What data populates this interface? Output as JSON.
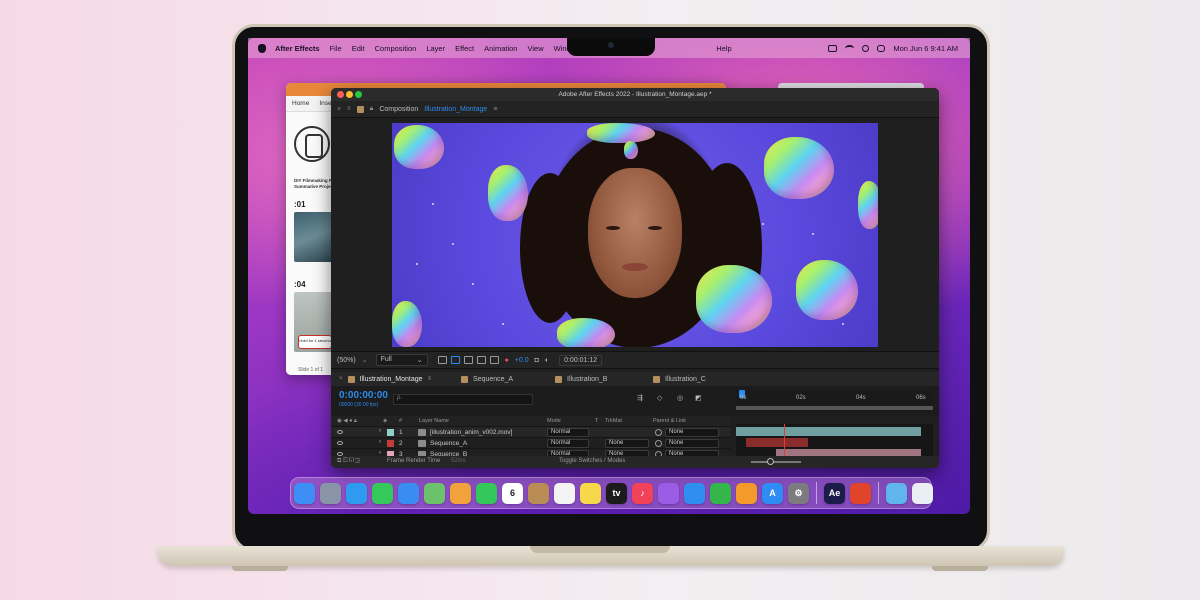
{
  "menubar": {
    "app_name": "After Effects",
    "items": [
      "File",
      "Edit",
      "Composition",
      "Layer",
      "Effect",
      "Animation",
      "View",
      "Window",
      "Help"
    ],
    "clock": "Mon Jun 6  9:41 AM"
  },
  "doc_window": {
    "toolbar": [
      "Home",
      "Inse"
    ],
    "slide_texts": [
      "DIY Filmmaking Pr",
      "Summative Project"
    ],
    "label_01": ":01",
    "label_04": ":04",
    "hold_note": "Hold for 1 second",
    "slide_count": "Slide 1 of 1"
  },
  "ae": {
    "window_title": "Adobe After Effects 2022 - Illustration_Montage.aep *",
    "comp_label": "Composition",
    "comp_name": "Illustration_Montage",
    "zoom": "(50%)",
    "resolution": "Full",
    "exposure": "+0.0",
    "current_time": "0:00:01:12",
    "timeline_tabs": [
      "Illustration_Montage",
      "Sequence_A",
      "Illustration_B",
      "Illustration_C"
    ],
    "timecode": "0:00:00:00",
    "timecode_sub": "00000 (30.00 fps)",
    "search_placeholder": "ρ.",
    "ruler_labels": [
      "0s",
      "02s",
      "04s",
      "06s"
    ],
    "columns": {
      "layer_name": "Layer Name",
      "mode": "Mode",
      "t": "T",
      "trkmat": "TrkMat",
      "parent": "Parent & Link",
      "num": "#"
    },
    "layers": [
      {
        "num": "1",
        "name": "[illustration_anim_v002.mov]",
        "mode": "Normal",
        "trkmat": "",
        "parent": "None",
        "color": "#8fd0c9"
      },
      {
        "num": "2",
        "name": "Sequence_A",
        "mode": "Normal",
        "trkmat": "None",
        "parent": "None",
        "color": "#c63a3a"
      },
      {
        "num": "3",
        "name": "Sequence_B",
        "mode": "Normal",
        "trkmat": "None",
        "parent": "None",
        "color": "#e0a7b5"
      }
    ],
    "footer": {
      "render_label": "Frame Render Time",
      "render_value": "52ms",
      "toggle": "Toggle Switches / Modes"
    }
  },
  "dock_apps": [
    {
      "name": "finder-icon",
      "color": "#3d8ff5",
      "glyph": ""
    },
    {
      "name": "launchpad-icon",
      "color": "#8a94a8",
      "glyph": ""
    },
    {
      "name": "safari-icon",
      "color": "#2f9bf0",
      "glyph": ""
    },
    {
      "name": "messages-icon",
      "color": "#35c85a",
      "glyph": ""
    },
    {
      "name": "mail-icon",
      "color": "#3a8cf2",
      "glyph": ""
    },
    {
      "name": "maps-icon",
      "color": "#6cc26a",
      "glyph": ""
    },
    {
      "name": "photos-icon",
      "color": "#f2a23a",
      "glyph": ""
    },
    {
      "name": "facetime-icon",
      "color": "#34c759",
      "glyph": ""
    },
    {
      "name": "calendar-icon",
      "color": "#ffffff",
      "glyph": "6"
    },
    {
      "name": "notes-brown-icon",
      "color": "#b98c55",
      "glyph": ""
    },
    {
      "name": "reminders-icon",
      "color": "#f4f4f4",
      "glyph": ""
    },
    {
      "name": "notes-icon",
      "color": "#f6d84a",
      "glyph": ""
    },
    {
      "name": "tv-icon",
      "color": "#1b1b1b",
      "glyph": "tv"
    },
    {
      "name": "music-icon",
      "color": "#f2425a",
      "glyph": "♪"
    },
    {
      "name": "podcasts-icon",
      "color": "#9b5de5",
      "glyph": ""
    },
    {
      "name": "keynote-icon",
      "color": "#2f8ff0",
      "glyph": ""
    },
    {
      "name": "numbers-icon",
      "color": "#34b64a",
      "glyph": ""
    },
    {
      "name": "pages-icon",
      "color": "#f39a2b",
      "glyph": ""
    },
    {
      "name": "app-store-icon",
      "color": "#2f8cf5",
      "glyph": "A"
    },
    {
      "name": "system-preferences-icon",
      "color": "#7b7b80",
      "glyph": "⚙"
    },
    {
      "name": "after-effects-icon",
      "color": "#1c1c4a",
      "glyph": "Ae"
    },
    {
      "name": "office-icon",
      "color": "#e0452b",
      "glyph": ""
    },
    {
      "name": "downloads-folder-icon",
      "color": "#5fb5ec",
      "glyph": ""
    },
    {
      "name": "trash-icon",
      "color": "#e8eef3",
      "glyph": ""
    }
  ]
}
